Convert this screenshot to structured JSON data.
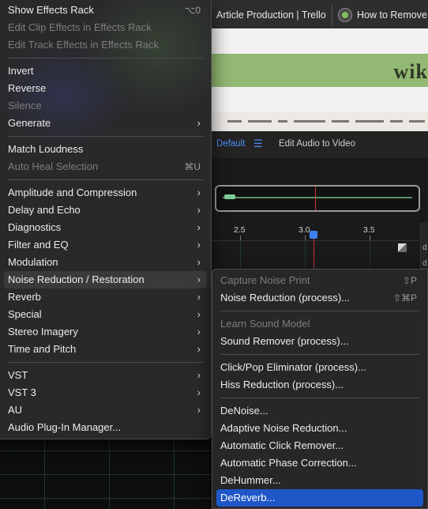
{
  "browser": {
    "tabs": [
      {
        "label": "Article Production | Trello"
      },
      {
        "label": "How to Remove"
      }
    ],
    "page_logo": "wik"
  },
  "workspace": {
    "default_label": "Default",
    "edit_label": "Edit Audio to Video",
    "menu_icon": "hamburger-icon"
  },
  "timeline": {
    "ticks": [
      "2.5",
      "3.0",
      "3.5"
    ],
    "side_labels": [
      "d",
      "d"
    ]
  },
  "main_menu": {
    "groups": [
      [
        {
          "label": "Show Effects Rack",
          "shortcut": "⌥0",
          "enabled": true
        },
        {
          "label": "Edit Clip Effects in Effects Rack",
          "enabled": false
        },
        {
          "label": "Edit Track Effects in Effects Rack",
          "enabled": false
        }
      ],
      [
        {
          "label": "Invert",
          "enabled": true
        },
        {
          "label": "Reverse",
          "enabled": true
        },
        {
          "label": "Silence",
          "enabled": false
        },
        {
          "label": "Generate",
          "submenu": true,
          "enabled": true
        }
      ],
      [
        {
          "label": "Match Loudness",
          "enabled": true
        },
        {
          "label": "Auto Heal Selection",
          "shortcut": "⌘U",
          "enabled": false
        }
      ],
      [
        {
          "label": "Amplitude and Compression",
          "submenu": true,
          "enabled": true
        },
        {
          "label": "Delay and Echo",
          "submenu": true,
          "enabled": true
        },
        {
          "label": "Diagnostics",
          "submenu": true,
          "enabled": true
        },
        {
          "label": "Filter and EQ",
          "submenu": true,
          "enabled": true
        },
        {
          "label": "Modulation",
          "submenu": true,
          "enabled": true
        },
        {
          "label": "Noise Reduction / Restoration",
          "submenu": true,
          "enabled": true,
          "highlighted": true
        },
        {
          "label": "Reverb",
          "submenu": true,
          "enabled": true
        },
        {
          "label": "Special",
          "submenu": true,
          "enabled": true
        },
        {
          "label": "Stereo Imagery",
          "submenu": true,
          "enabled": true
        },
        {
          "label": "Time and Pitch",
          "submenu": true,
          "enabled": true
        }
      ],
      [
        {
          "label": "VST",
          "submenu": true,
          "enabled": true
        },
        {
          "label": "VST 3",
          "submenu": true,
          "enabled": true
        },
        {
          "label": "AU",
          "submenu": true,
          "enabled": true
        },
        {
          "label": "Audio Plug-In Manager...",
          "enabled": true
        }
      ]
    ]
  },
  "sub_menu": {
    "groups": [
      [
        {
          "label": "Capture Noise Print",
          "shortcut": "⇧P",
          "enabled": false
        },
        {
          "label": "Noise Reduction (process)...",
          "shortcut": "⇧⌘P",
          "enabled": true
        }
      ],
      [
        {
          "label": "Learn Sound Model",
          "enabled": false
        },
        {
          "label": "Sound Remover (process)...",
          "enabled": true
        }
      ],
      [
        {
          "label": "Click/Pop Eliminator (process)...",
          "enabled": true
        },
        {
          "label": "Hiss Reduction (process)...",
          "enabled": true
        }
      ],
      [
        {
          "label": "DeNoise...",
          "enabled": true
        },
        {
          "label": "Adaptive Noise Reduction...",
          "enabled": true
        },
        {
          "label": "Automatic Click Remover...",
          "enabled": true
        },
        {
          "label": "Automatic Phase Correction...",
          "enabled": true
        },
        {
          "label": "DeHummer...",
          "enabled": true
        },
        {
          "label": "DeReverb...",
          "enabled": true,
          "selected": true
        }
      ]
    ]
  },
  "colors": {
    "selection": "#1f57c8",
    "accent_blue": "#4d8ff5",
    "playhead": "#c23a3a"
  }
}
